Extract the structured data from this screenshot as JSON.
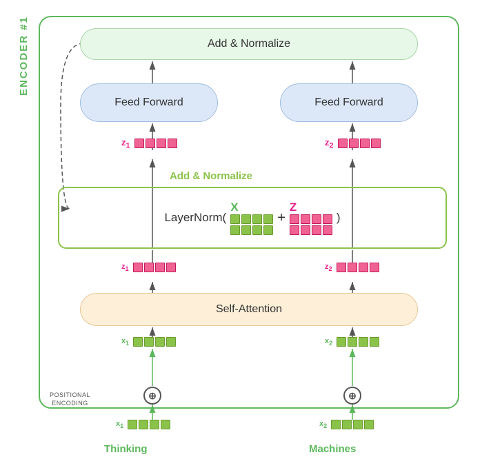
{
  "encoder": {
    "label": "ENCODER #1",
    "add_norm_top": "Add & Normalize",
    "feed_forward_left": "Feed Forward",
    "feed_forward_right": "Feed Forward",
    "add_norm_mid": "Add & Normalize",
    "layernorm": "LayerNorm(",
    "layernorm_plus": "+",
    "layernorm_close": ")",
    "self_attention": "Self-Attention",
    "positional_encoding": "POSITIONAL\nENCODING",
    "z1_label": "z",
    "z1_sub": "1",
    "z2_label": "z",
    "z2_sub": "2",
    "x1_label": "x",
    "x1_sub": "1",
    "x2_label": "x",
    "x2_sub": "2",
    "x_var": "X",
    "z_var": "Z",
    "thinking": "Thinking",
    "machines": "Machines",
    "plus_symbol": "⊕"
  }
}
